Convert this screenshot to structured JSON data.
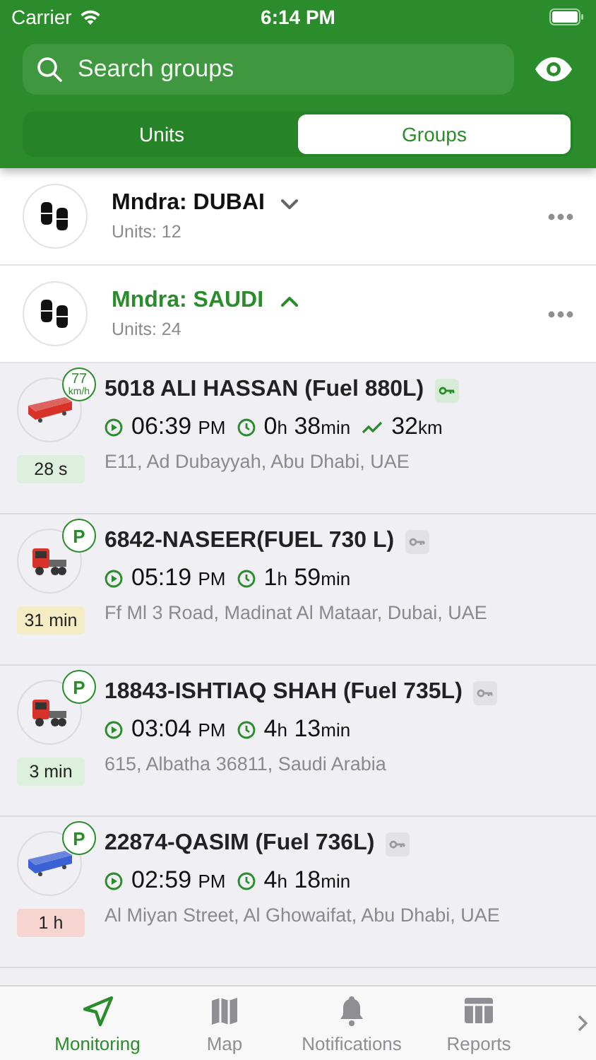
{
  "status_bar": {
    "carrier": "Carrier",
    "time": "6:14 PM"
  },
  "header": {
    "search": {
      "placeholder": "Search groups"
    },
    "segments": [
      {
        "label": "Units",
        "selected": false
      },
      {
        "label": "Groups",
        "selected": true
      }
    ]
  },
  "groups": [
    {
      "name": "Mndra: DUBAI",
      "units": "Units: 12",
      "expanded": false
    },
    {
      "name": "Mndra: SAUDI",
      "units": "Units: 24",
      "expanded": true
    }
  ],
  "units": [
    {
      "name": "5018 ALI HASSAN (Fuel 880L)",
      "vehicle": {
        "kind": "trailer",
        "color": "#d8332b"
      },
      "badge": {
        "kind": "speed",
        "value": "77",
        "unit": "km/h"
      },
      "ignition": true,
      "start_time": "06:39",
      "start_period": "PM",
      "duration": [
        {
          "value": "0",
          "unit": "h"
        },
        {
          "value": "38",
          "unit": "min"
        }
      ],
      "mileage": {
        "value": "32",
        "unit": "km"
      },
      "address": "E11, Ad Dubayyah, Abu Dhabi, UAE",
      "age": {
        "label": "28 s",
        "color": "#ddefdd"
      }
    },
    {
      "name": "6842-NASEER(FUEL 730 L)",
      "vehicle": {
        "kind": "tractor",
        "color": "#d8332b"
      },
      "badge": {
        "kind": "parked",
        "label": "P"
      },
      "ignition": false,
      "start_time": "05:19",
      "start_period": "PM",
      "duration": [
        {
          "value": "1",
          "unit": "h"
        },
        {
          "value": "59",
          "unit": "min"
        }
      ],
      "address": "Ff Ml 3 Road, Madinat Al Mataar, Dubai, UAE",
      "age": {
        "label": "31 min",
        "color": "#f6ecc4"
      }
    },
    {
      "name": "18843-ISHTIAQ SHAH (Fuel 735L)",
      "vehicle": {
        "kind": "tractor",
        "color": "#d8332b"
      },
      "badge": {
        "kind": "parked",
        "label": "P"
      },
      "ignition": false,
      "start_time": "03:04",
      "start_period": "PM",
      "duration": [
        {
          "value": "4",
          "unit": "h"
        },
        {
          "value": "13",
          "unit": "min"
        }
      ],
      "address": "615, Albatha 36811, Saudi Arabia",
      "age": {
        "label": "3 min",
        "color": "#ddefdd"
      }
    },
    {
      "name": "22874-QASIM (Fuel 736L)",
      "vehicle": {
        "kind": "trailer",
        "color": "#3a62d6"
      },
      "badge": {
        "kind": "parked",
        "label": "P"
      },
      "ignition": false,
      "start_time": "02:59",
      "start_period": "PM",
      "duration": [
        {
          "value": "4",
          "unit": "h"
        },
        {
          "value": "18",
          "unit": "min"
        }
      ],
      "address": "Al Miyan Street, Al Ghowaifat, Abu Dhabi, UAE",
      "age": {
        "label": "1 h",
        "color": "#f6d4d0"
      }
    }
  ],
  "tab_bar": [
    {
      "label": "Monitoring",
      "kind": "navigate",
      "selected": true
    },
    {
      "label": "Map",
      "kind": "map",
      "selected": false
    },
    {
      "label": "Notifications",
      "kind": "bell",
      "selected": false
    },
    {
      "label": "Reports",
      "kind": "table",
      "selected": false
    }
  ]
}
